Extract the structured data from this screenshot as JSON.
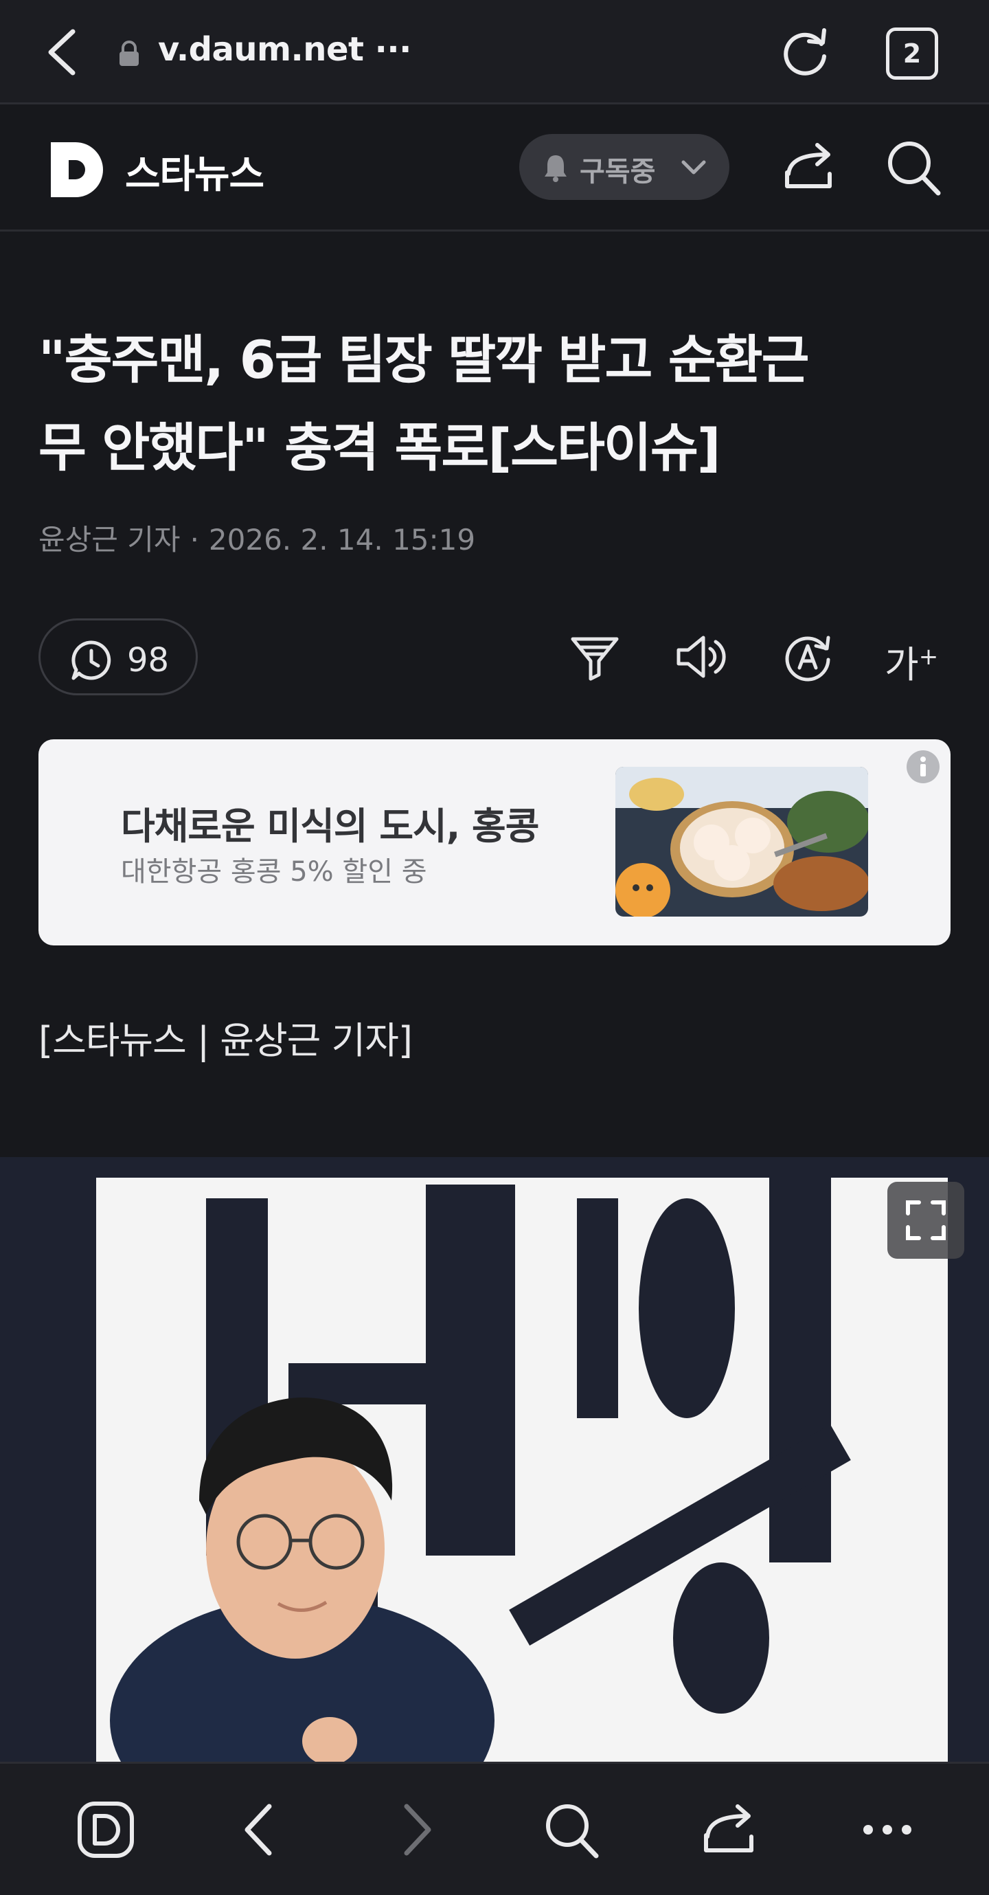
{
  "browser": {
    "url": "v.daum.net ···",
    "tab_count": "2",
    "icons": [
      "chevron-left-icon",
      "lock-icon",
      "reload-icon",
      "tabs-icon"
    ]
  },
  "site": {
    "brand": "스타뉴스",
    "subscribe_label": "구독중",
    "icons": [
      "daum-logo-icon",
      "bell-icon",
      "chevron-down-icon",
      "share-icon",
      "search-icon"
    ]
  },
  "article": {
    "headline_line1": "\"충주맨, 6급 팀장 딸깍 받고 순환근",
    "headline_line2": "무 안했다\" 충격 폭로[스타이슈]",
    "author": "윤상근 기자",
    "dot": "·",
    "datetime": "2026. 2. 14. 15:19",
    "comment_count": "98",
    "font_size_label": "가",
    "byline": "[스타뉴스 | 윤상근 기자]"
  },
  "ad": {
    "title": "다채로운 미식의 도시, 홍콩",
    "subtitle": "대한항공 홍콩 5% 할인 중"
  },
  "colors": {
    "background": "#17181c",
    "bar": "#1c1d22",
    "ad_background": "#f4f4f6",
    "pill": "#35363c"
  }
}
